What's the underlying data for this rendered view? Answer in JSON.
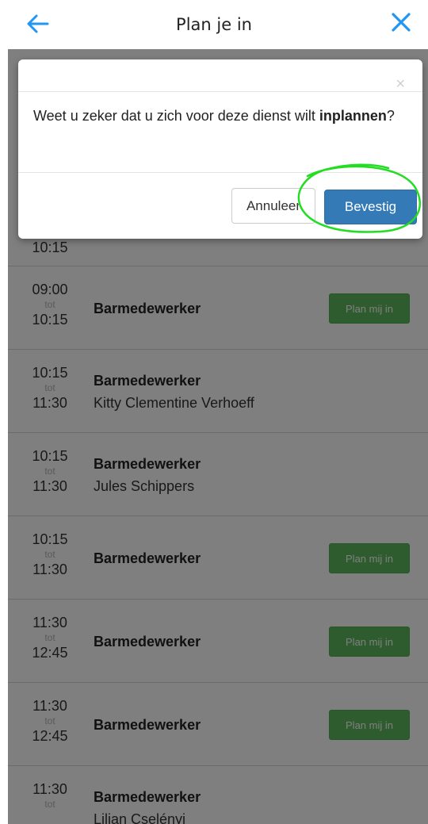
{
  "header": {
    "title": "Plan je in",
    "back_icon": "arrow-left-icon",
    "close_icon": "close-icon",
    "accent_color": "#2196f3"
  },
  "shifts": [
    {
      "end": "10:15",
      "role": "",
      "person": "",
      "button": ""
    },
    {
      "start": "09:00",
      "tot": "tot",
      "end": "10:15",
      "role": "Barmedewerker",
      "person": "",
      "button": "Plan mij in"
    },
    {
      "start": "10:15",
      "tot": "tot",
      "end": "11:30",
      "role": "Barmedewerker",
      "person": "Kitty Clementine Verhoeff",
      "button": ""
    },
    {
      "start": "10:15",
      "tot": "tot",
      "end": "11:30",
      "role": "Barmedewerker",
      "person": "Jules Schippers",
      "button": ""
    },
    {
      "start": "10:15",
      "tot": "tot",
      "end": "11:30",
      "role": "Barmedewerker",
      "person": "",
      "button": "Plan mij in"
    },
    {
      "start": "11:30",
      "tot": "tot",
      "end": "12:45",
      "role": "Barmedewerker",
      "person": "",
      "button": "Plan mij in"
    },
    {
      "start": "11:30",
      "tot": "tot",
      "end": "12:45",
      "role": "Barmedewerker",
      "person": "",
      "button": "Plan mij in"
    },
    {
      "start": "11:30",
      "tot": "tot",
      "end": "",
      "role": "Barmedewerker",
      "person": "Lilian Cselényi",
      "button": ""
    }
  ],
  "modal": {
    "close_symbol": "×",
    "message_prefix": "Weet u zeker dat u zich voor deze dienst wilt ",
    "message_bold": "inplannen",
    "message_suffix": "?",
    "cancel_label": "Annuleer",
    "confirm_label": "Bevestig",
    "confirm_color": "#337ab7"
  },
  "annotation": {
    "color": "#22dd22"
  }
}
